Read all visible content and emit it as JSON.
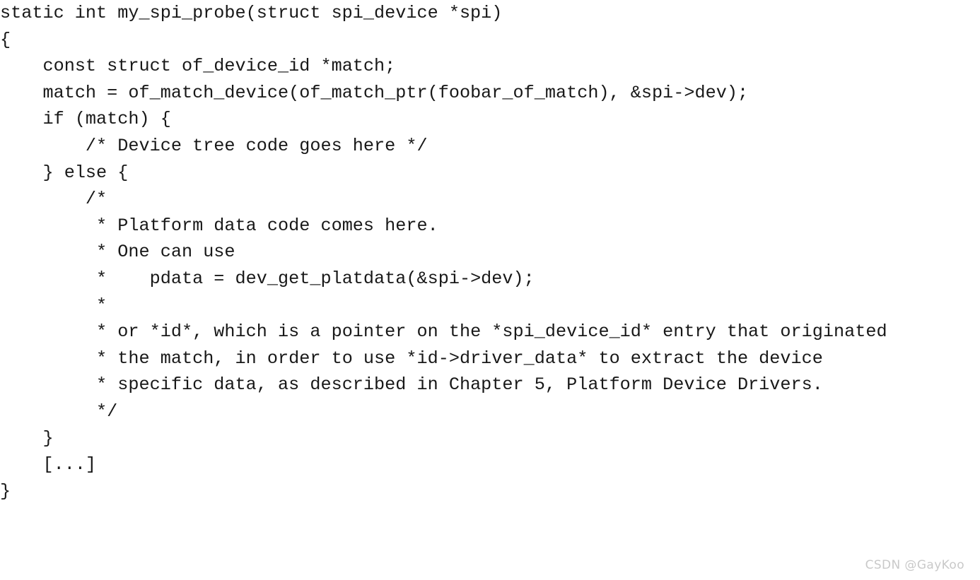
{
  "document": {
    "type": "source-code-listing",
    "language": "c",
    "background_color": "#ffffff",
    "text_color": "#181818",
    "font_kind": "monospace"
  },
  "code": {
    "lines": [
      "static int my_spi_probe(struct spi_device *spi)",
      "{",
      "    const struct of_device_id *match;",
      "    match = of_match_device(of_match_ptr(foobar_of_match), &spi->dev);",
      "    if (match) {",
      "        /* Device tree code goes here */",
      "    } else {",
      "        /*",
      "         * Platform data code comes here.",
      "         * One can use",
      "         *    pdata = dev_get_platdata(&spi->dev);",
      "         *",
      "         * or *id*, which is a pointer on the *spi_device_id* entry that originated",
      "         * the match, in order to use *id->driver_data* to extract the device",
      "         * specific data, as described in Chapter 5, Platform Device Drivers.",
      "         */",
      "    }",
      "    [...]",
      "}"
    ]
  },
  "watermark": {
    "text": "CSDN @GayKoo",
    "color": "#c9c9c9"
  }
}
